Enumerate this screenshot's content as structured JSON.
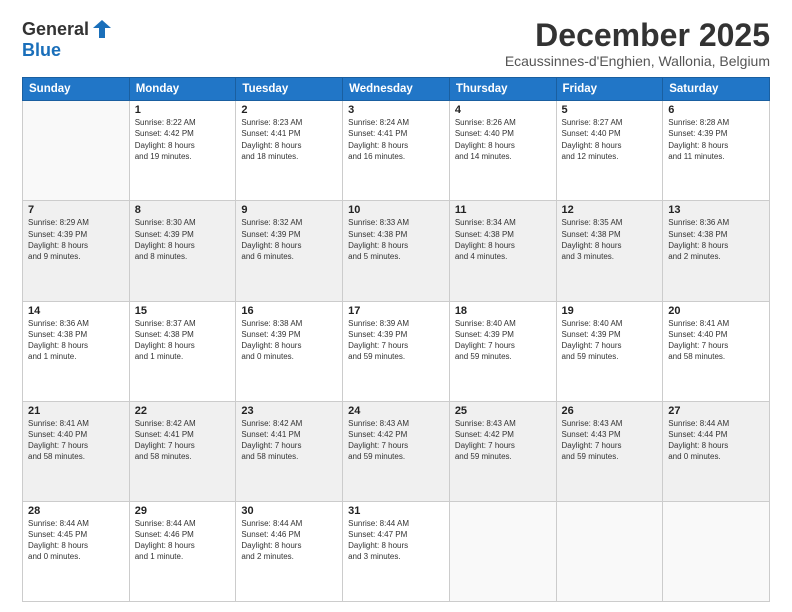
{
  "logo": {
    "general": "General",
    "blue": "Blue"
  },
  "title": "December 2025",
  "subtitle": "Ecaussinnes-d'Enghien, Wallonia, Belgium",
  "headers": [
    "Sunday",
    "Monday",
    "Tuesday",
    "Wednesday",
    "Thursday",
    "Friday",
    "Saturday"
  ],
  "weeks": [
    [
      {
        "day": "",
        "info": ""
      },
      {
        "day": "1",
        "info": "Sunrise: 8:22 AM\nSunset: 4:42 PM\nDaylight: 8 hours\nand 19 minutes."
      },
      {
        "day": "2",
        "info": "Sunrise: 8:23 AM\nSunset: 4:41 PM\nDaylight: 8 hours\nand 18 minutes."
      },
      {
        "day": "3",
        "info": "Sunrise: 8:24 AM\nSunset: 4:41 PM\nDaylight: 8 hours\nand 16 minutes."
      },
      {
        "day": "4",
        "info": "Sunrise: 8:26 AM\nSunset: 4:40 PM\nDaylight: 8 hours\nand 14 minutes."
      },
      {
        "day": "5",
        "info": "Sunrise: 8:27 AM\nSunset: 4:40 PM\nDaylight: 8 hours\nand 12 minutes."
      },
      {
        "day": "6",
        "info": "Sunrise: 8:28 AM\nSunset: 4:39 PM\nDaylight: 8 hours\nand 11 minutes."
      }
    ],
    [
      {
        "day": "7",
        "info": "Sunrise: 8:29 AM\nSunset: 4:39 PM\nDaylight: 8 hours\nand 9 minutes."
      },
      {
        "day": "8",
        "info": "Sunrise: 8:30 AM\nSunset: 4:39 PM\nDaylight: 8 hours\nand 8 minutes."
      },
      {
        "day": "9",
        "info": "Sunrise: 8:32 AM\nSunset: 4:39 PM\nDaylight: 8 hours\nand 6 minutes."
      },
      {
        "day": "10",
        "info": "Sunrise: 8:33 AM\nSunset: 4:38 PM\nDaylight: 8 hours\nand 5 minutes."
      },
      {
        "day": "11",
        "info": "Sunrise: 8:34 AM\nSunset: 4:38 PM\nDaylight: 8 hours\nand 4 minutes."
      },
      {
        "day": "12",
        "info": "Sunrise: 8:35 AM\nSunset: 4:38 PM\nDaylight: 8 hours\nand 3 minutes."
      },
      {
        "day": "13",
        "info": "Sunrise: 8:36 AM\nSunset: 4:38 PM\nDaylight: 8 hours\nand 2 minutes."
      }
    ],
    [
      {
        "day": "14",
        "info": "Sunrise: 8:36 AM\nSunset: 4:38 PM\nDaylight: 8 hours\nand 1 minute."
      },
      {
        "day": "15",
        "info": "Sunrise: 8:37 AM\nSunset: 4:38 PM\nDaylight: 8 hours\nand 1 minute."
      },
      {
        "day": "16",
        "info": "Sunrise: 8:38 AM\nSunset: 4:39 PM\nDaylight: 8 hours\nand 0 minutes."
      },
      {
        "day": "17",
        "info": "Sunrise: 8:39 AM\nSunset: 4:39 PM\nDaylight: 7 hours\nand 59 minutes."
      },
      {
        "day": "18",
        "info": "Sunrise: 8:40 AM\nSunset: 4:39 PM\nDaylight: 7 hours\nand 59 minutes."
      },
      {
        "day": "19",
        "info": "Sunrise: 8:40 AM\nSunset: 4:39 PM\nDaylight: 7 hours\nand 59 minutes."
      },
      {
        "day": "20",
        "info": "Sunrise: 8:41 AM\nSunset: 4:40 PM\nDaylight: 7 hours\nand 58 minutes."
      }
    ],
    [
      {
        "day": "21",
        "info": "Sunrise: 8:41 AM\nSunset: 4:40 PM\nDaylight: 7 hours\nand 58 minutes."
      },
      {
        "day": "22",
        "info": "Sunrise: 8:42 AM\nSunset: 4:41 PM\nDaylight: 7 hours\nand 58 minutes."
      },
      {
        "day": "23",
        "info": "Sunrise: 8:42 AM\nSunset: 4:41 PM\nDaylight: 7 hours\nand 58 minutes."
      },
      {
        "day": "24",
        "info": "Sunrise: 8:43 AM\nSunset: 4:42 PM\nDaylight: 7 hours\nand 59 minutes."
      },
      {
        "day": "25",
        "info": "Sunrise: 8:43 AM\nSunset: 4:42 PM\nDaylight: 7 hours\nand 59 minutes."
      },
      {
        "day": "26",
        "info": "Sunrise: 8:43 AM\nSunset: 4:43 PM\nDaylight: 7 hours\nand 59 minutes."
      },
      {
        "day": "27",
        "info": "Sunrise: 8:44 AM\nSunset: 4:44 PM\nDaylight: 8 hours\nand 0 minutes."
      }
    ],
    [
      {
        "day": "28",
        "info": "Sunrise: 8:44 AM\nSunset: 4:45 PM\nDaylight: 8 hours\nand 0 minutes."
      },
      {
        "day": "29",
        "info": "Sunrise: 8:44 AM\nSunset: 4:46 PM\nDaylight: 8 hours\nand 1 minute."
      },
      {
        "day": "30",
        "info": "Sunrise: 8:44 AM\nSunset: 4:46 PM\nDaylight: 8 hours\nand 2 minutes."
      },
      {
        "day": "31",
        "info": "Sunrise: 8:44 AM\nSunset: 4:47 PM\nDaylight: 8 hours\nand 3 minutes."
      },
      {
        "day": "",
        "info": ""
      },
      {
        "day": "",
        "info": ""
      },
      {
        "day": "",
        "info": ""
      }
    ]
  ]
}
